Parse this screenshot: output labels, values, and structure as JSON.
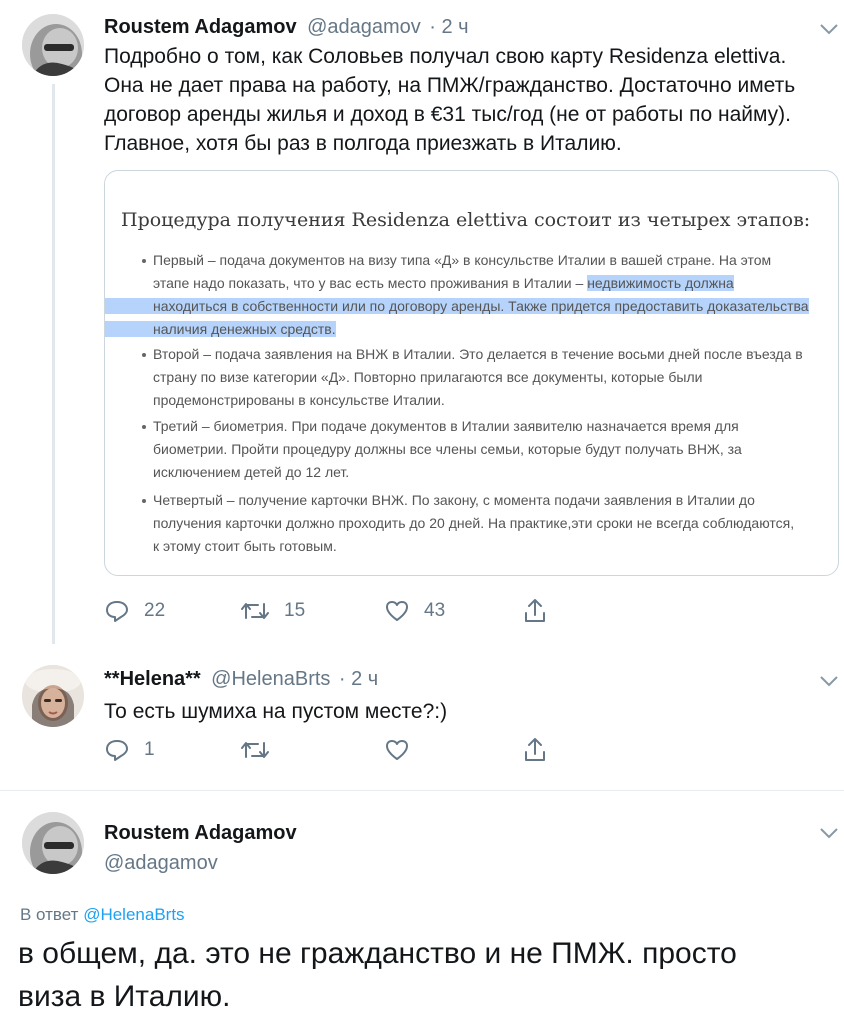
{
  "tweet1": {
    "name": "Roustem Adagamov",
    "handle": "@adagamov",
    "time": "· 2 ч",
    "text_lines": [
      "Подробно о том, как Соловьев получал свою карту Residenza elettiva.",
      "Она не дает права на работу, на ПМЖ/гражданство. Достаточно иметь",
      "договор аренды жилья и доход в €31 тыс/год (не от работы по найму).",
      "Главное, хотя бы раз в полгода приезжать в Италию."
    ],
    "card": {
      "title": "Процедура получения Residenza elettiva состоит из четырех этапов:",
      "bullets": [
        {
          "line1": "Первый – подача документов на визу типа «Д» в консульстве Италии в вашей стране. На этом",
          "line2_plain": "этапе надо показать, что у вас есть место проживания в Италии – ",
          "line2_hl": "недвижимость должна",
          "line3_hl": "находиться в собственности или по договору аренды. Также придется предоставить доказательства",
          "line4_hl": "наличия денежных средств."
        },
        {
          "line1": "Второй – подача заявления на ВНЖ в Италии. Это делается в течение восьми дней после въезда в",
          "line2": "страну по визе категории «Д». Повторно прилагаются все документы, которые были",
          "line3": "продемонстрированы в консульстве Италии."
        },
        {
          "line1": "Третий – биометрия. При подаче документов в Италии заявителю назначается время для",
          "line2": "биометрии. Пройти процедуру должны все члены семьи, которые будут получать ВНЖ, за",
          "line3": "исключением детей до 12 лет."
        },
        {
          "line1": "Четвертый – получение карточки ВНЖ. По закону, с момента подачи заявления в Италии до",
          "line2": "получения карточки должно проходить до 20 дней. На практике,эти сроки не всегда соблюдаются,",
          "line3": "к этому стоит быть готовым."
        }
      ]
    },
    "actions": {
      "replies": "22",
      "retweets": "15",
      "likes": "43"
    }
  },
  "tweet2": {
    "name": "**Helena**",
    "handle": "@HelenaBrts",
    "time": "· 2 ч",
    "text": "То есть шумиха на пустом месте?:)",
    "actions": {
      "replies": "1"
    }
  },
  "tweet3": {
    "name": "Roustem Adagamov",
    "handle": "@adagamov",
    "reply_prefix": "В ответ",
    "reply_to": "@HelenaBrts",
    "text_lines": [
      "в общем, да. это не гражданство и не ПМЖ. просто",
      "виза в Италию."
    ]
  },
  "icons": {
    "reply": "reply-icon",
    "retweet": "retweet-icon",
    "like": "heart-icon",
    "share": "share-icon",
    "chevron": "chevron-down-icon"
  },
  "colors": {
    "accent": "#1da1f2",
    "muted": "#657786",
    "highlight": "#b6d4fb",
    "divider": "#e1e8ed"
  }
}
